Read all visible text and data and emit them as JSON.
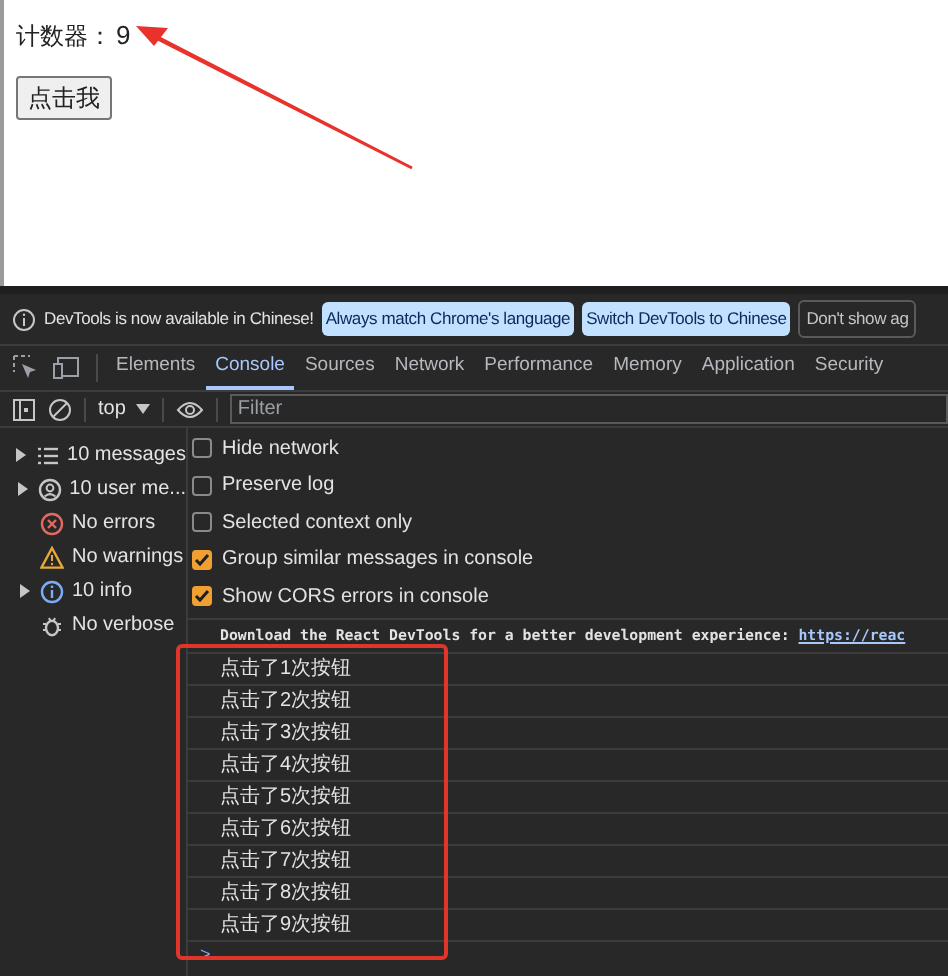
{
  "page": {
    "counter_label": "计数器：",
    "counter_value": "9",
    "button": "点击我"
  },
  "banner": {
    "message": "DevTools is now available in Chinese!",
    "buttons": [
      "Always match Chrome's language",
      "Switch DevTools to Chinese"
    ],
    "dismiss": "Don't show ag"
  },
  "tabs": [
    {
      "label": "Elements",
      "selected": false
    },
    {
      "label": "Console",
      "selected": true
    },
    {
      "label": "Sources",
      "selected": false
    },
    {
      "label": "Network",
      "selected": false
    },
    {
      "label": "Performance",
      "selected": false
    },
    {
      "label": "Memory",
      "selected": false
    },
    {
      "label": "Application",
      "selected": false
    },
    {
      "label": "Security",
      "selected": false
    }
  ],
  "toolbar": {
    "context": "top",
    "filter": {
      "placeholder": "Filter"
    }
  },
  "sidebar": [
    {
      "kind": "messages",
      "label": "10 messages",
      "expandable": true
    },
    {
      "kind": "user",
      "label": "10 user me...",
      "expandable": true
    },
    {
      "kind": "errors",
      "label": "No errors",
      "expandable": false
    },
    {
      "kind": "warnings",
      "label": "No warnings",
      "expandable": false
    },
    {
      "kind": "info",
      "label": "10 info",
      "expandable": true
    },
    {
      "kind": "verbose",
      "label": "No verbose",
      "expandable": false
    }
  ],
  "settings": [
    {
      "label": "Hide network",
      "checked": false
    },
    {
      "label": "Preserve log",
      "checked": false
    },
    {
      "label": "Selected context only",
      "checked": false
    },
    {
      "label": "Group similar messages in console",
      "checked": true
    },
    {
      "label": "Show CORS errors in console",
      "checked": true
    }
  ],
  "log": {
    "text": "Download the React DevTools for a better development experience: ",
    "link": "https://reac"
  },
  "messages": [
    "点击了1次按钮",
    "点击了2次按钮",
    "点击了3次按钮",
    "点击了4次按钮",
    "点击了5次按钮",
    "点击了6次按钮",
    "点击了7次按钮",
    "点击了8次按钮",
    "点击了9次按钮"
  ],
  "prompt": ">"
}
